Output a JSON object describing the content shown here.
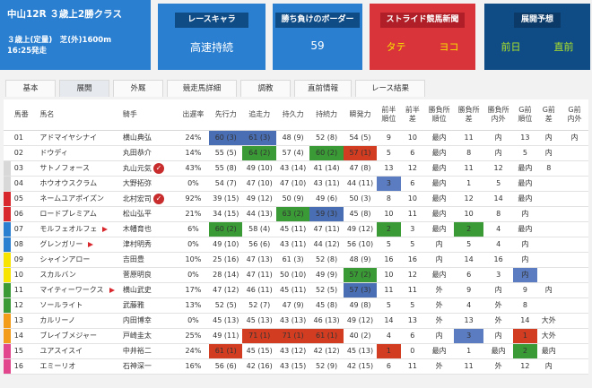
{
  "race": {
    "title": "中山12R ３歳上2勝クラス",
    "cond": "３歳上(定量)　芝(外)1600m",
    "start": "16:25発走"
  },
  "chara": {
    "label": "レースキャラ",
    "value": "高速持続"
  },
  "border": {
    "label": "勝ち負けのボーダー",
    "value": "59"
  },
  "stride": {
    "label": "ストライド競馬新聞",
    "a": "タテ",
    "b": "ヨコ"
  },
  "tenkai": {
    "label": "展開予想",
    "a": "前日",
    "b": "直前"
  },
  "tabs": [
    "基本",
    "展開",
    "外厩",
    "競走馬詳細",
    "調教",
    "直前情報",
    "レース結果"
  ],
  "headers": [
    "馬番",
    "馬名",
    "騎手",
    "出遅率",
    "先行力",
    "追走力",
    "持久力",
    "持続力",
    "瞬発力",
    "前半\n順位",
    "前半\n差",
    "勝負所\n順位",
    "勝負所\n差",
    "勝負所\n内外",
    "G前\n順位",
    "G前\n差",
    "G前\n内外"
  ],
  "rows": [
    {
      "no": "01",
      "name": "アドマイヤシナイ",
      "jockey": "横山典弘",
      "rate": "24%",
      "s": "60 (3)",
      "o": "61 (3)",
      "j": "48 (9)",
      "k": "52 (8)",
      "sh": "54 (5)",
      "p1": "9",
      "p2": "10",
      "p3": "最内",
      "p4": "11",
      "p5": "内",
      "p6": "13",
      "p7": "内",
      "p8": "内",
      "color": "#ffffff"
    },
    {
      "no": "02",
      "name": "ドウディ",
      "jockey": "丸田恭介",
      "rate": "14%",
      "s": "55 (5)",
      "o": "64 (2)",
      "j": "57 (4)",
      "k": "60 (2)",
      "sh": "57 (1)",
      "p1": "5",
      "p2": "6",
      "p3": "最内",
      "p4": "8",
      "p5": "内",
      "p6": "5",
      "p7": "内",
      "p8": "",
      "color": "#ffffff"
    },
    {
      "no": "03",
      "name": "サトノフォース",
      "jockey": "丸山元気",
      "rate": "43%",
      "s": "55 (8)",
      "o": "49 (10)",
      "j": "43 (14)",
      "k": "41 (14)",
      "sh": "47 (8)",
      "p1": "13",
      "p2": "12",
      "p3": "最内",
      "p4": "11",
      "p5": "12",
      "p6": "最内",
      "p7": "8",
      "p8": "",
      "color": "#d8d8d8"
    },
    {
      "no": "04",
      "name": "ホウオウスクラム",
      "jockey": "大野拓弥",
      "rate": "0%",
      "s": "54 (7)",
      "o": "47 (10)",
      "j": "47 (10)",
      "k": "43 (11)",
      "sh": "44 (11)",
      "p1": "3",
      "p2": "6",
      "p3": "最内",
      "p4": "1",
      "p5": "5",
      "p6": "最内",
      "p7": "",
      "p8": "",
      "color": "#d8d8d8"
    },
    {
      "no": "05",
      "name": "ネームユアポイズン",
      "jockey": "北村宏司",
      "rate": "92%",
      "s": "39 (15)",
      "o": "49 (12)",
      "j": "50 (9)",
      "k": "49 (6)",
      "sh": "50 (3)",
      "p1": "8",
      "p2": "10",
      "p3": "最内",
      "p4": "12",
      "p5": "14",
      "p6": "最内",
      "p7": "",
      "p8": "",
      "color": "#d8282e"
    },
    {
      "no": "06",
      "name": "ロードプレミアム",
      "jockey": "松山弘平",
      "rate": "21%",
      "s": "34 (15)",
      "o": "44 (13)",
      "j": "63 (2)",
      "k": "59 (3)",
      "sh": "45 (8)",
      "p1": "10",
      "p2": "11",
      "p3": "最内",
      "p4": "10",
      "p5": "8",
      "p6": "内",
      "p7": "",
      "p8": "",
      "color": "#d8282e"
    },
    {
      "no": "07",
      "name": "モルフェオルフェ",
      "jockey": "木幡育也",
      "rate": "6%",
      "s": "60 (2)",
      "o": "58 (4)",
      "j": "45 (11)",
      "k": "47 (11)",
      "sh": "49 (12)",
      "p1": "2",
      "p2": "3",
      "p3": "最内",
      "p4": "2",
      "p5": "4",
      "p6": "最内",
      "p7": "",
      "p8": "",
      "color": "#2a7fd0"
    },
    {
      "no": "08",
      "name": "グレンガリー",
      "jockey": "津村明秀",
      "rate": "0%",
      "s": "49 (10)",
      "o": "56 (6)",
      "j": "43 (11)",
      "k": "44 (12)",
      "sh": "56 (10)",
      "p1": "5",
      "p2": "5",
      "p3": "内",
      "p4": "5",
      "p5": "4",
      "p6": "内",
      "p7": "",
      "p8": "",
      "color": "#2a7fd0"
    },
    {
      "no": "09",
      "name": "シャインアロー",
      "jockey": "吉田豊",
      "rate": "10%",
      "s": "25 (16)",
      "o": "47 (13)",
      "j": "61 (3)",
      "k": "52 (8)",
      "sh": "48 (9)",
      "p1": "16",
      "p2": "16",
      "p3": "内",
      "p4": "14",
      "p5": "16",
      "p6": "内",
      "p7": "",
      "p8": "",
      "color": "#f7e400"
    },
    {
      "no": "10",
      "name": "スカルバン",
      "jockey": "菅原明良",
      "rate": "0%",
      "s": "28 (14)",
      "o": "47 (11)",
      "j": "50 (10)",
      "k": "49 (9)",
      "sh": "57 (2)",
      "p1": "10",
      "p2": "12",
      "p3": "最内",
      "p4": "6",
      "p5": "3",
      "p6": "内",
      "p7": "",
      "p8": "",
      "color": "#f7e400"
    },
    {
      "no": "11",
      "name": "マイティーワークス",
      "jockey": "横山武史",
      "rate": "17%",
      "s": "47 (12)",
      "o": "46 (11)",
      "j": "45 (11)",
      "k": "52 (5)",
      "sh": "57 (3)",
      "p1": "11",
      "p2": "11",
      "p3": "外",
      "p4": "9",
      "p5": "内",
      "p6": "9",
      "p7": "内",
      "p8": "",
      "color": "#3a9a35"
    },
    {
      "no": "12",
      "name": "ソールライト",
      "jockey": "武藤雅",
      "rate": "13%",
      "s": "52 (5)",
      "o": "52 (7)",
      "j": "47 (9)",
      "k": "45 (8)",
      "sh": "49 (8)",
      "p1": "5",
      "p2": "5",
      "p3": "外",
      "p4": "4",
      "p5": "外",
      "p6": "8",
      "p7": "",
      "p8": "",
      "color": "#3a9a35"
    },
    {
      "no": "13",
      "name": "カルリーノ",
      "jockey": "内田博幸",
      "rate": "0%",
      "s": "45 (13)",
      "o": "45 (13)",
      "j": "43 (13)",
      "k": "46 (13)",
      "sh": "49 (12)",
      "p1": "14",
      "p2": "13",
      "p3": "外",
      "p4": "13",
      "p5": "外",
      "p6": "14",
      "p7": "大外",
      "p8": "",
      "color": "#f39c1a"
    },
    {
      "no": "14",
      "name": "ブレイブメジャー",
      "jockey": "戸崎圭太",
      "rate": "25%",
      "s": "49 (11)",
      "o": "71 (1)",
      "j": "71 (1)",
      "k": "61 (1)",
      "sh": "40 (2)",
      "p1": "4",
      "p2": "6",
      "p3": "内",
      "p4": "3",
      "p5": "内",
      "p6": "1",
      "p7": "大外",
      "p8": "",
      "color": "#f39c1a"
    },
    {
      "no": "15",
      "name": "ユアスイスイ",
      "jockey": "中井裕二",
      "rate": "24%",
      "s": "61 (1)",
      "o": "45 (15)",
      "j": "43 (12)",
      "k": "42 (12)",
      "sh": "45 (13)",
      "p1": "1",
      "p2": "0",
      "p3": "最内",
      "p4": "1",
      "p5": "最内",
      "p6": "2",
      "p7": "最内",
      "p8": "",
      "color": "#e2478e"
    },
    {
      "no": "16",
      "name": "エミーリオ",
      "jockey": "石神深一",
      "rate": "16%",
      "s": "56 (6)",
      "o": "42 (16)",
      "j": "43 (15)",
      "k": "52 (9)",
      "sh": "42 (15)",
      "p1": "6",
      "p2": "11",
      "p3": "外",
      "p4": "11",
      "p5": "外",
      "p6": "12",
      "p7": "内",
      "p8": "",
      "color": "#e2478e"
    }
  ]
}
